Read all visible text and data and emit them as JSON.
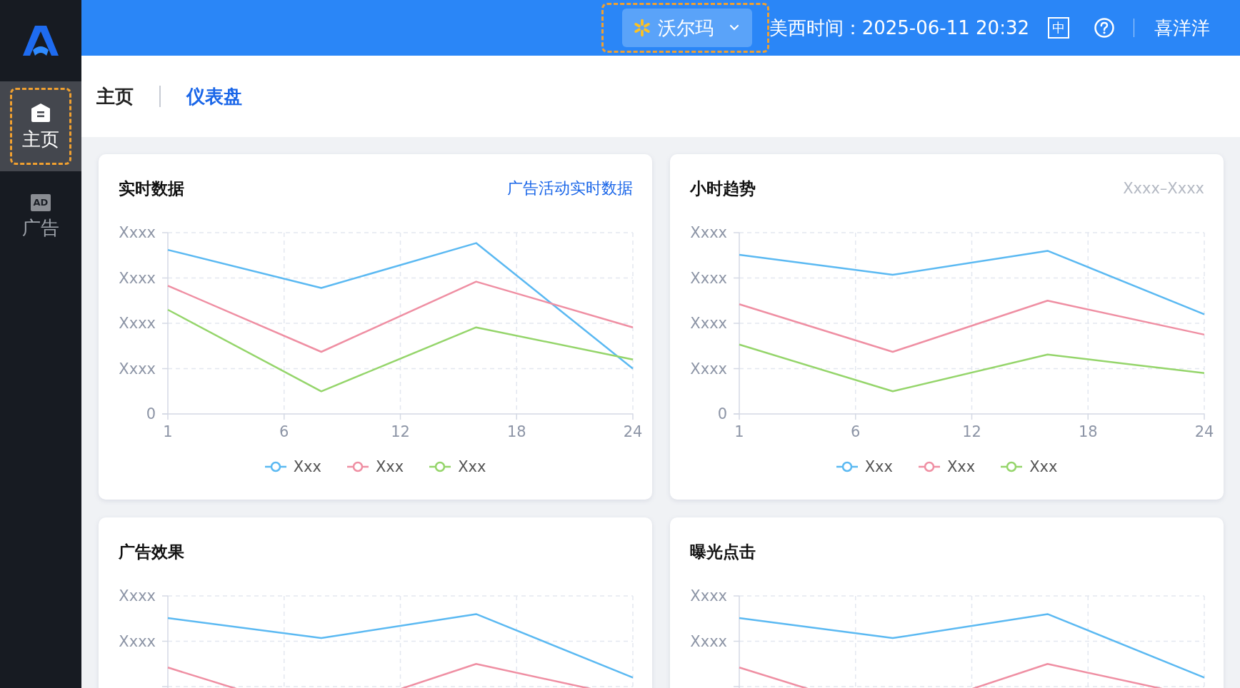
{
  "sidebar": {
    "items": [
      {
        "kind": "home",
        "label": "主页",
        "selected": true,
        "highlighted": true
      },
      {
        "kind": "ad",
        "badge": "AD",
        "label": "广告",
        "selected": false,
        "highlighted": false
      }
    ]
  },
  "topbar": {
    "store": {
      "label": "沃尔玛",
      "highlighted": true
    },
    "time": "美西时间：2025-06-11 20:32",
    "language": "中",
    "user": "喜洋洋"
  },
  "breadcrumb": [
    {
      "label": "主页",
      "selected": false
    },
    {
      "label": "仪表盘",
      "selected": true
    }
  ],
  "cards": [
    {
      "title": "实时数据",
      "link": "广告活动实时数据",
      "y_labels": [
        "Xxxx",
        "Xxxx",
        "Xxxx",
        "Xxxx",
        "0"
      ],
      "x_labels": [
        "1",
        "6",
        "12",
        "18",
        "24"
      ],
      "series": [
        {
          "name": "Xxx",
          "color": "#5bb9f2"
        },
        {
          "name": "Xxx",
          "color": "#ef8fa3"
        },
        {
          "name": "Xxx",
          "color": "#95d56b"
        }
      ]
    },
    {
      "title": "小时趋势",
      "note": "Xxxx–Xxxx",
      "y_labels": [
        "Xxxx",
        "Xxxx",
        "Xxxx",
        "Xxxx",
        "0"
      ],
      "x_labels": [
        "1",
        "6",
        "12",
        "18",
        "24"
      ],
      "series": [
        {
          "name": "Xxx",
          "color": "#5bb9f2"
        },
        {
          "name": "Xxx",
          "color": "#ef8fa3"
        },
        {
          "name": "Xxx",
          "color": "#95d56b"
        }
      ]
    },
    {
      "title": "广告效果",
      "y_labels": [
        "Xxxx",
        "Xxxx"
      ],
      "series": [
        {
          "color": "#5bb9f2"
        },
        {
          "color": "#ef8fa3"
        }
      ]
    },
    {
      "title": "曝光点击",
      "y_labels": [
        "Xxxx",
        "Xxxx"
      ],
      "series": [
        {
          "color": "#5bb9f2"
        },
        {
          "color": "#ef8fa3"
        }
      ]
    }
  ]
}
